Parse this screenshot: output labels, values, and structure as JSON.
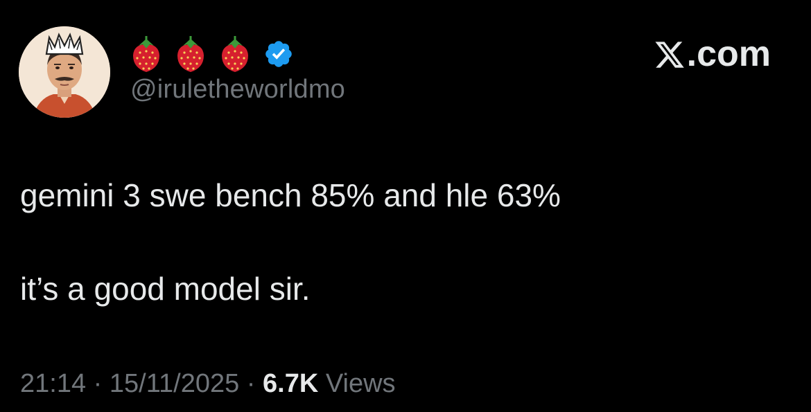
{
  "user": {
    "display_name_icons": [
      "strawberry-icon",
      "strawberry-icon",
      "strawberry-icon"
    ],
    "verified_icon": "verified-badge-icon",
    "handle": "@iruletheworldmo",
    "avatar_icon": "avatar-crowned-man"
  },
  "brand": {
    "logo_icon": "x-logo-icon",
    "suffix": ".com"
  },
  "tweet": {
    "line1": "gemini 3 swe bench 85% and hle 63%",
    "line2": "it’s a good model sir."
  },
  "meta": {
    "time": "21:14",
    "separator1": " · ",
    "date": "15/11/2025",
    "separator2": " · ",
    "views_count": "6.7K",
    "views_label": " Views"
  },
  "colors": {
    "background": "#000000",
    "text": "#e7e9ea",
    "muted": "#71767b",
    "verified": "#1d9bf0",
    "strawberry": "#d6202e"
  }
}
